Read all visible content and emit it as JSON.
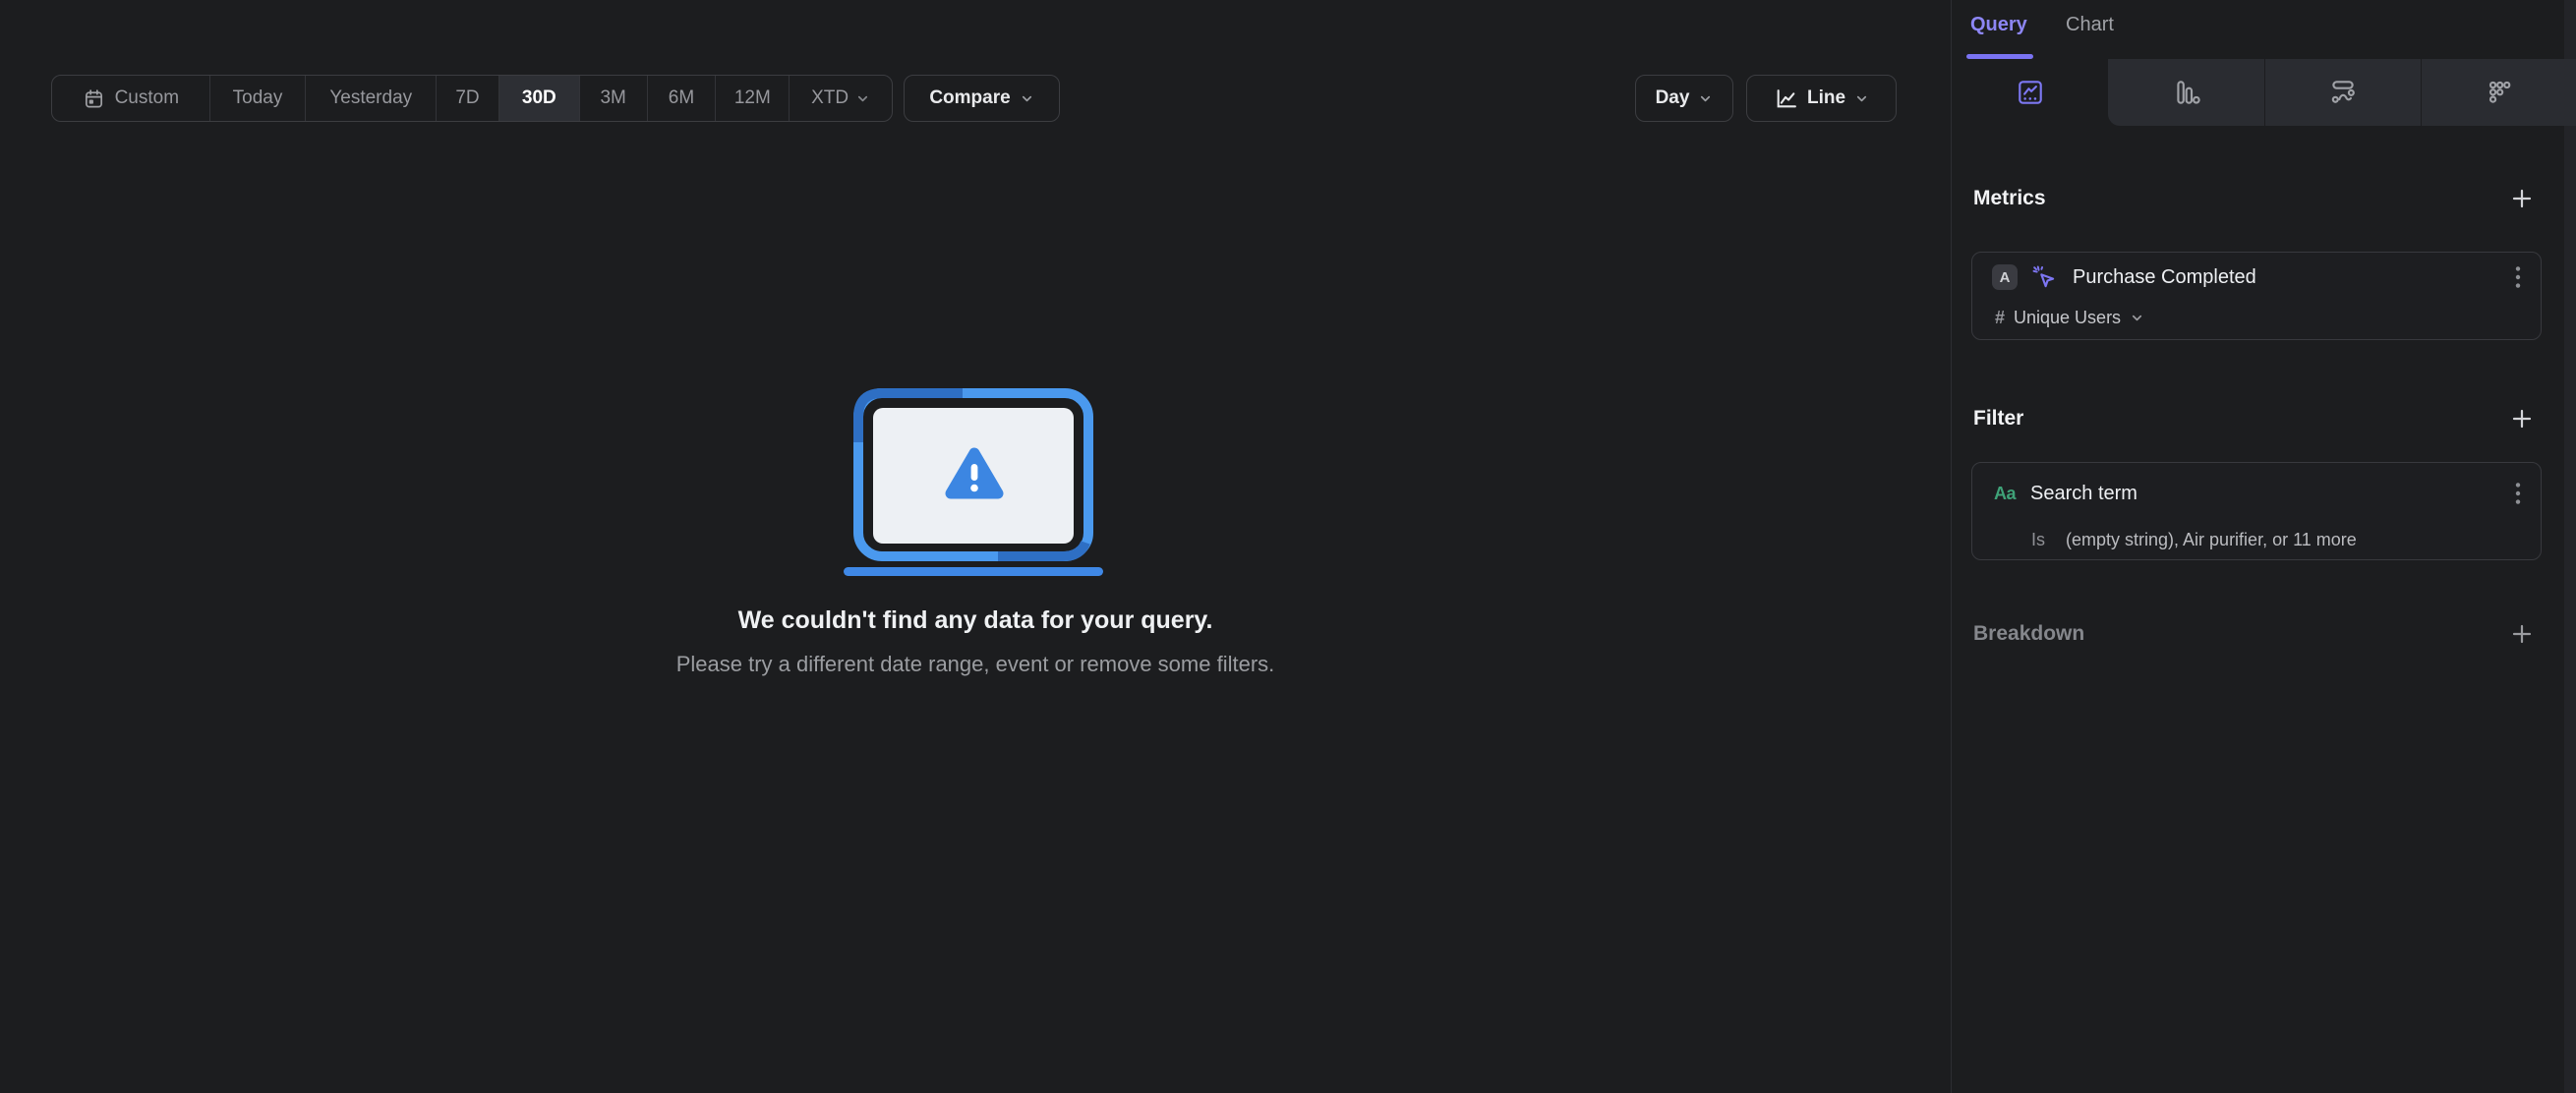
{
  "toolbar": {
    "date_ranges": [
      {
        "label": "Custom",
        "selected": false,
        "icon": "calendar-icon"
      },
      {
        "label": "Today",
        "selected": false
      },
      {
        "label": "Yesterday",
        "selected": false
      },
      {
        "label": "7D",
        "selected": false
      },
      {
        "label": "30D",
        "selected": true
      },
      {
        "label": "3M",
        "selected": false
      },
      {
        "label": "6M",
        "selected": false
      },
      {
        "label": "12M",
        "selected": false
      },
      {
        "label": "XTD",
        "selected": false,
        "icon": "chevron-down-icon"
      }
    ],
    "compare": {
      "label": "Compare",
      "icon": "chevron-down-icon"
    },
    "granularity": {
      "label": "Day",
      "icon": "chevron-down-icon"
    },
    "chart_type": {
      "label": "Line",
      "icons": [
        "line-chart-icon",
        "chevron-down-icon"
      ]
    }
  },
  "empty_state": {
    "illustration": "laptop-warning-icon",
    "title": "We couldn't find any data for your query.",
    "subtitle": "Please try a different date range, event or remove some filters."
  },
  "sidebar": {
    "tabs": [
      {
        "label": "Query",
        "active": true
      },
      {
        "label": "Chart",
        "active": false
      }
    ],
    "view_tabs": [
      {
        "icon": "insights-icon",
        "active": true
      },
      {
        "icon": "bar-chart-icon",
        "active": false
      },
      {
        "icon": "flows-icon",
        "active": false
      },
      {
        "icon": "retention-icon",
        "active": false
      }
    ],
    "metrics": {
      "heading": "Metrics",
      "add_icon": "plus-icon",
      "items": [
        {
          "badge": "A",
          "icon": "event-click-icon",
          "name": "Purchase Completed",
          "aggregation_symbol": "#",
          "aggregation": "Unique Users",
          "aggregation_icon": "chevron-down-icon",
          "menu_icon": "kebab-icon"
        }
      ]
    },
    "filter": {
      "heading": "Filter",
      "add_icon": "plus-icon",
      "items": [
        {
          "type_icon_label": "Aa",
          "name": "Search term",
          "operator": "Is",
          "values": "(empty string), Air purifier, or 11 more",
          "menu_icon": "kebab-icon"
        }
      ]
    },
    "breakdown": {
      "heading": "Breakdown",
      "add_icon": "plus-icon"
    }
  },
  "colors": {
    "background": "#1c1d1f",
    "accent_purple": "#7d76f3",
    "illustration_blue": "#3f88e6",
    "string_property_green": "#3fa278",
    "selected_segment_bg": "#2d2f34"
  }
}
